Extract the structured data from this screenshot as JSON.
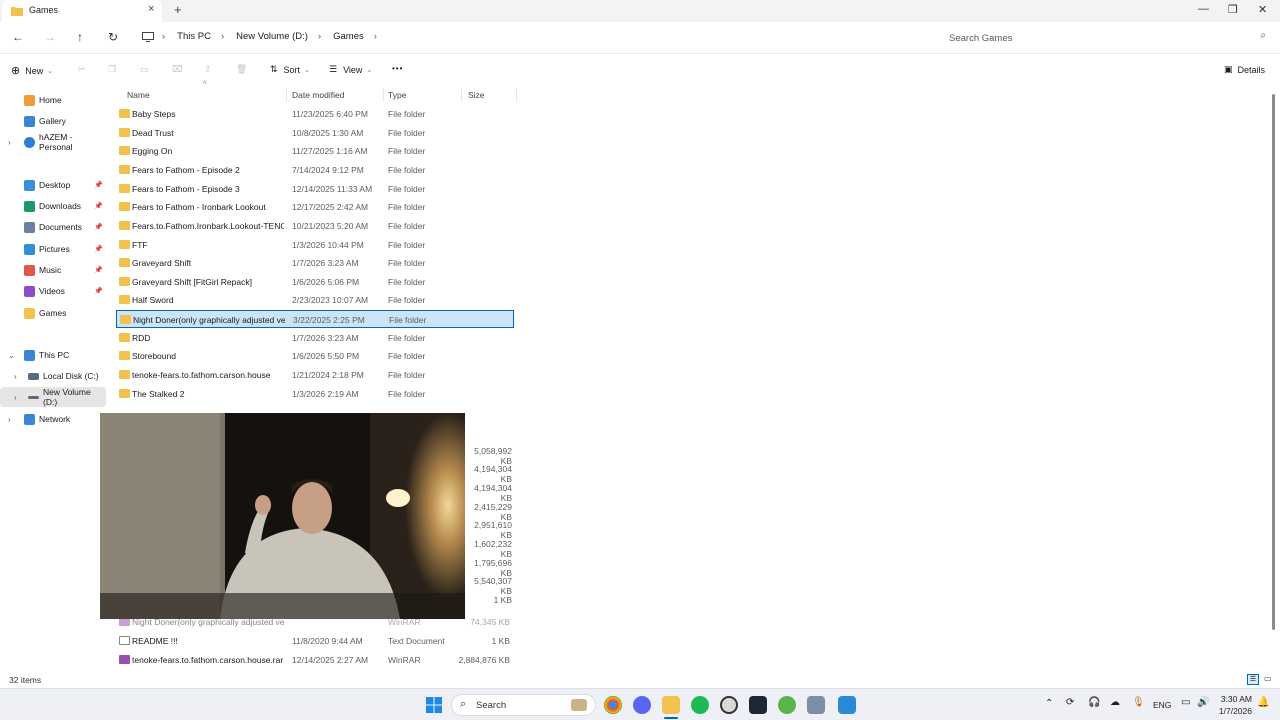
{
  "window": {
    "tab_title": "Games",
    "new_tab": "+",
    "close_tab": "×",
    "minimize": "—",
    "maximize": "❐",
    "close": "✕"
  },
  "address": {
    "crumbs": [
      "This PC",
      "New Volume (D:)",
      "Games"
    ],
    "search_placeholder": "Search Games"
  },
  "toolbar": {
    "new_label": "New",
    "sort_label": "Sort",
    "view_label": "View",
    "more_label": "•••",
    "details_label": "Details"
  },
  "nav": {
    "items": [
      {
        "label": "Home"
      },
      {
        "label": "Gallery"
      },
      {
        "label": "hAZEM - Personal"
      },
      {
        "label": "Desktop"
      },
      {
        "label": "Downloads"
      },
      {
        "label": "Documents"
      },
      {
        "label": "Pictures"
      },
      {
        "label": "Music"
      },
      {
        "label": "Videos"
      },
      {
        "label": "Games"
      },
      {
        "label": "This PC"
      },
      {
        "label": "Local Disk (C:)"
      },
      {
        "label": "New Volume (D:)"
      },
      {
        "label": "Network"
      }
    ]
  },
  "columns": {
    "name": "Name",
    "date": "Date modified",
    "type": "Type",
    "size": "Size"
  },
  "files": [
    {
      "name": "Baby Steps",
      "date": "11/23/2025 6:40 PM",
      "type": "File folder"
    },
    {
      "name": "Dead Trust",
      "date": "10/8/2025 1:30 AM",
      "type": "File folder"
    },
    {
      "name": "Egging On",
      "date": "11/27/2025 1:16 AM",
      "type": "File folder"
    },
    {
      "name": "Fears to Fathom - Episode 2",
      "date": "7/14/2024 9:12 PM",
      "type": "File folder"
    },
    {
      "name": "Fears to Fathom - Episode 3",
      "date": "12/14/2025 11:33 AM",
      "type": "File folder"
    },
    {
      "name": "Fears to Fathom - Ironbark Lookout",
      "date": "12/17/2025 2:42 AM",
      "type": "File folder"
    },
    {
      "name": "Fears.to.Fathom.Ironbark.Lookout-TENO...",
      "date": "10/21/2023 5:20 AM",
      "type": "File folder"
    },
    {
      "name": "FTF",
      "date": "1/3/2026 10:44 PM",
      "type": "File folder"
    },
    {
      "name": "Graveyard Shift",
      "date": "1/7/2026 3:23 AM",
      "type": "File folder"
    },
    {
      "name": "Graveyard Shift [FitGirl Repack]",
      "date": "1/6/2026 5:06 PM",
      "type": "File folder"
    },
    {
      "name": "Half Sword",
      "date": "2/23/2023 10:07 AM",
      "type": "File folder"
    },
    {
      "name": "Night Doner(only graphically adjusted ve...",
      "date": "3/22/2025 2:25 PM",
      "type": "File folder"
    },
    {
      "name": "RDD",
      "date": "1/7/2026 3:23 AM",
      "type": "File folder"
    },
    {
      "name": "Storebound",
      "date": "1/6/2026 5:50 PM",
      "type": "File folder"
    },
    {
      "name": "tenoke-fears.to.fathom.carson.house",
      "date": "1/21/2024 2:18 PM",
      "type": "File folder"
    },
    {
      "name": "The Stalked 2",
      "date": "1/3/2026 2:19 AM",
      "type": "File folder"
    }
  ],
  "partial_sizes": [
    "5,058,992 KB",
    "4,194,304 KB",
    "4,194,304 KB",
    "2,415,229 KB",
    "2,951,610 KB",
    "1,602,232 KB",
    "1,795,696 KB",
    "5,540,307 KB",
    "1 KB"
  ],
  "lower_files": [
    {
      "name": "Night Doner(only graphically adjusted ve...",
      "date": "",
      "type": "WinRAR",
      "size": "74,345 KB"
    },
    {
      "name": "README !!!",
      "date": "11/8/2020 9:44 AM",
      "type": "Text Document",
      "size": "1 KB"
    },
    {
      "name": "tenoke-fears.to.fathom.carson.house.rar",
      "date": "12/14/2025 2:27 AM",
      "type": "WinRAR",
      "size": "2,884,876 KB"
    }
  ],
  "status": {
    "count": "32 items"
  },
  "taskbar": {
    "search_label": "Search",
    "lang": "ENG",
    "time": "3:30 AM",
    "date": "1/7/2026"
  },
  "colors": {
    "accent": "#0067c0",
    "selection": "#cce4f7",
    "folder": "#f2c14e"
  }
}
